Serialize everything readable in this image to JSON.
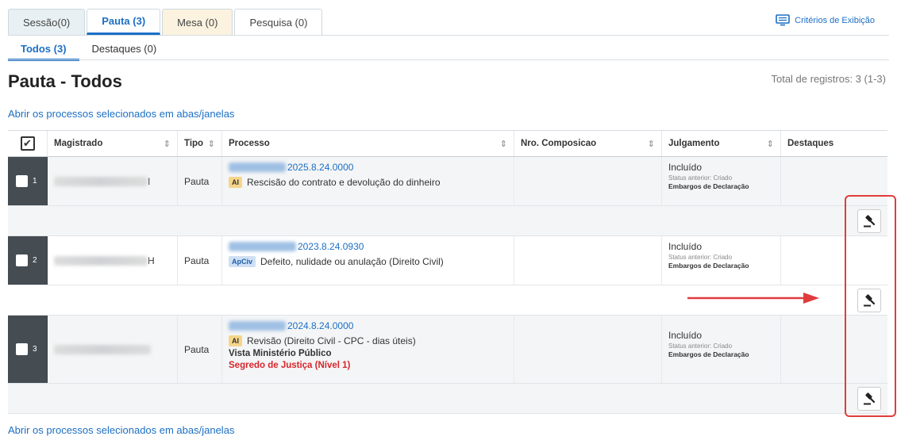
{
  "tabs": [
    {
      "label": "Sessão(0)"
    },
    {
      "label": "Pauta (3)"
    },
    {
      "label": "Mesa (0)"
    },
    {
      "label": "Pesquisa (0)"
    }
  ],
  "subtabs": [
    {
      "label": "Todos (3)"
    },
    {
      "label": "Destaques (0)"
    }
  ],
  "criteria_label": "Critérios de Exibição",
  "page_title": "Pauta - Todos",
  "total": "Total de registros: 3 (1-3)",
  "open_link": "Abrir os processos selecionados em abas/janelas",
  "columns": {
    "magistrado": "Magistrado",
    "tipo": "Tipo",
    "processo": "Processo",
    "composicao": "Nro. Composicao",
    "julgamento": "Julgamento",
    "destaques": "Destaques"
  },
  "sort_glyph": "⇕",
  "rows": [
    {
      "num": "1",
      "magistrado_suffix": "I",
      "tipo": "Pauta",
      "processo_suffix": "2025.8.24.0000",
      "classe_badge": "AI",
      "classe_text": "Rescisão do contrato e devolução do dinheiro",
      "julg_main": "Incluído",
      "julg_sub": "Status anterior: Criado",
      "julg_emb": "Embargos de Declaração"
    },
    {
      "num": "2",
      "magistrado_suffix": "H",
      "tipo": "Pauta",
      "processo_suffix": "2023.8.24.0930",
      "classe_badge": "ApCiv",
      "classe_text": "Defeito, nulidade ou anulação (Direito Civil)",
      "julg_main": "Incluído",
      "julg_sub": "Status anterior: Criado",
      "julg_emb": "Embargos de Declaração"
    },
    {
      "num": "3",
      "magistrado_suffix": "",
      "tipo": "Pauta",
      "processo_suffix": "2024.8.24.0000",
      "classe_badge": "AI",
      "classe_text": "Revisão (Direito Civil - CPC - dias úteis)",
      "extra_bold": "Vista Ministério Público",
      "extra_red": "Segredo de Justiça (Nível 1)",
      "julg_main": "Incluído",
      "julg_sub": "Status anterior: Criado",
      "julg_emb": "Embargos de Declaração"
    }
  ],
  "header_check": "✔",
  "colors": {
    "accent": "#1c6fc4",
    "highlight": "#e03c3c",
    "row_selector": "#454c52"
  }
}
